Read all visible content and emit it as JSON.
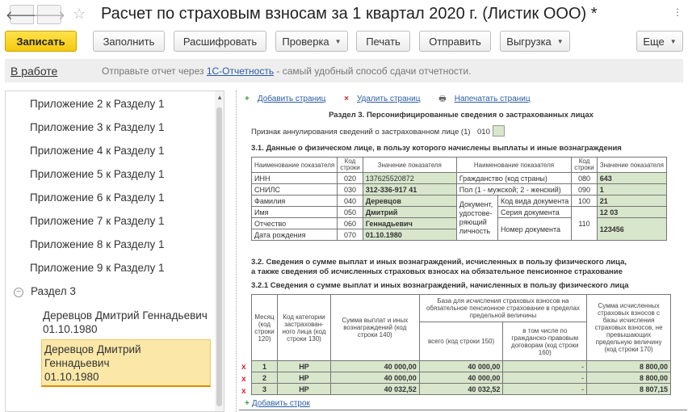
{
  "window": {
    "title": "Расчет по страховым взносам за 1 квартал 2020 г. (Листик ООО) *",
    "back_glyph": "🡐",
    "forward_glyph": "🡒",
    "star_glyph": "☆",
    "more_glyph": "⋮"
  },
  "toolbar": {
    "save": "Записать",
    "fill": "Заполнить",
    "decode": "Расшифровать",
    "check": "Проверка",
    "print": "Печать",
    "send": "Отправить",
    "export": "Выгрузка",
    "more": "Еще"
  },
  "infobar": {
    "status": "В работе",
    "msg_before": "Отправьте отчет через ",
    "msg_link": "1С-Отчетность",
    "msg_after": " - самый удобный способ сдачи отчетности."
  },
  "tree": {
    "items": [
      "Приложение 2 к Разделу 1",
      "Приложение 3 к Разделу 1",
      "Приложение 4 к Разделу 1",
      "Приложение 5 к Разделу 1",
      "Приложение 6 к Разделу 1",
      "Приложение 7 к Разделу 1",
      "Приложение 8 к Разделу 1",
      "Приложение 9 к Разделу 1"
    ],
    "group_label": "Раздел 3",
    "persons": [
      {
        "name": "Деревцов Дмитрий Геннадьевич",
        "date": "01.10.1980"
      },
      {
        "name": "Деревцов Дмитрий Геннадьевич",
        "date": "01.10.1980"
      }
    ]
  },
  "doc": {
    "actions": {
      "add": "Добавить страниц",
      "delete": "Удалить страниц",
      "print": "Напечатать страниц"
    },
    "section_title": "Раздел 3. Персонифицированные сведения о застрахованных лицах",
    "cancel_label": "Признак аннулирования сведений о застрахованном лице (1)",
    "cancel_code": "010",
    "s31_title": "3.1. Данные о физическом лице, в пользу которого начислены выплаты и иные вознаграждения",
    "person_table": {
      "h_name": "Наименование показателя",
      "h_code": "Код строки",
      "h_value": "Значение показателя",
      "left_rows": [
        {
          "label": "ИНН",
          "code": "020",
          "value": "137625520872"
        },
        {
          "label": "СНИЛС",
          "code": "030",
          "value": "312-336-917 41"
        },
        {
          "label": "Фамилия",
          "code": "040",
          "value": "Деревцов"
        },
        {
          "label": "Имя",
          "code": "050",
          "value": "Дмитрий"
        },
        {
          "label": "Отчество",
          "code": "060",
          "value": "Геннадьевич"
        },
        {
          "label": "Дата рождения",
          "code": "070",
          "value": "01.10.1980"
        }
      ],
      "citizenship": {
        "label": "Гражданство (код страны)",
        "code": "080",
        "value": "643"
      },
      "gender": {
        "label": "Пол (1 - мужской; 2 - женский)",
        "code": "090",
        "value": "1"
      },
      "doc_group": "Документ, удостове-ряющий личность",
      "doc_kind": {
        "label": "Код вида документа",
        "code": "100",
        "value": "21"
      },
      "doc_series": {
        "label": "Серия документа",
        "value": "12 03"
      },
      "doc_number": {
        "label": "Номер документа",
        "value": "123456"
      },
      "doc_code": "110"
    },
    "s32_title_1": "3.2. Сведения о сумме выплат и иных вознаграждений, исчисленных в пользу физического лица,",
    "s32_title_2": "а также сведения об исчисленных страховых взносах на обязательное пенсионное страхование",
    "s321_title": "3.2.1 Сведения о сумме выплат и иных вознаграждений, начисленных в пользу физического лица",
    "pay_table": {
      "h_month": "Месяц (код строки 120)",
      "h_cat": "Код категории застрахован-ного лица (код строки 130)",
      "h_sum": "Сумма выплат и иных вознаграждений (код строки 140)",
      "h_base": "База для исчисления страховых взносов на обязательное пенсионное страхование в пределах предельной величины",
      "h_total": "всего (код строки 150)",
      "h_gpd": "в том числе по гражданско-правовым договорам (код строки 160)",
      "h_contrib": "Сумма исчисленных страховых взносов с базы исчисления страховых взносов, не превышающих предельную величину (код строки 170)",
      "rows": [
        {
          "mark": "x",
          "month": "1",
          "cat": "НР",
          "sum": "40 000,00",
          "base": "40 000,00",
          "gpd": "-",
          "contrib": "8 800,00"
        },
        {
          "mark": "x",
          "month": "2",
          "cat": "НР",
          "sum": "40 000,00",
          "base": "40 000,00",
          "gpd": "-",
          "contrib": "8 800,00"
        },
        {
          "mark": "x",
          "month": "3",
          "cat": "НР",
          "sum": "40 032,52",
          "base": "40 032,52",
          "gpd": "-",
          "contrib": "8 807,15"
        }
      ]
    },
    "add_rows": "Добавить строк"
  }
}
